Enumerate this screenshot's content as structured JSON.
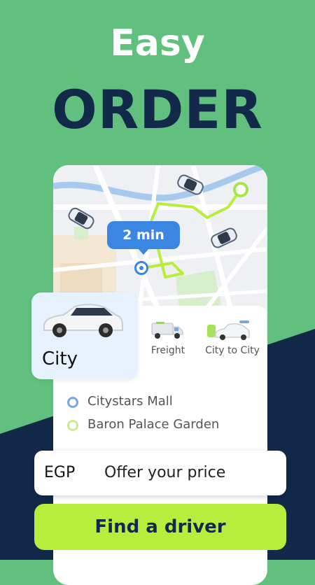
{
  "headline": {
    "line1": "Easy",
    "line2": "ORDER"
  },
  "map": {
    "eta_label": "2 min",
    "car_icon": "car-top-view-icon"
  },
  "service_tabs": [
    {
      "label": "City",
      "icon": "sedan-car-icon",
      "selected": true
    },
    {
      "label": "Freight",
      "icon": "truck-icon",
      "selected": false
    },
    {
      "label": "City to City",
      "icon": "car-with-luggage-icon",
      "selected": false
    }
  ],
  "route": {
    "pickup": "Citystars Mall",
    "destination": "Baron Palace Garden"
  },
  "price": {
    "currency": "EGP",
    "placeholder": "Offer your price"
  },
  "cta": {
    "label": "Find a driver"
  },
  "colors": {
    "background_green": "#61c07e",
    "background_navy": "#12294a",
    "accent_lime": "#b7ee3e",
    "route_blue": "#3a86e0"
  }
}
